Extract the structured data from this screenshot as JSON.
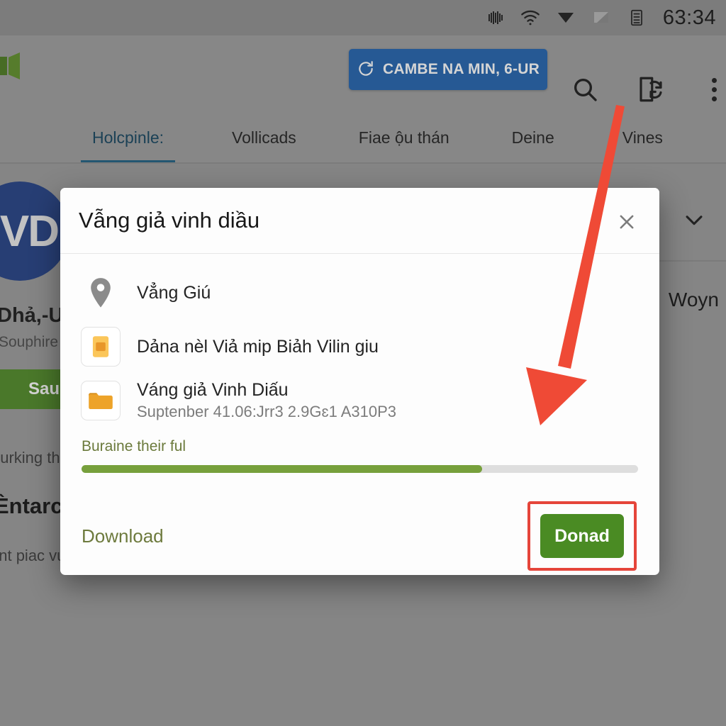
{
  "status_bar": {
    "clock": "63:34",
    "icons": [
      "vibrate-icon",
      "wifi-icon",
      "signal-icon",
      "signal-secondary-icon",
      "battery-icon"
    ]
  },
  "app_bar": {
    "logo": "app-logo-icon",
    "cta_label": "CAMBE NA MIN, 6-UR",
    "cta_icon": "sync-icon",
    "cta_color": "#2062ad",
    "search_icon": "search-icon",
    "cast_icon": "cast-document-icon",
    "overflow_icon": "more-vertical-icon"
  },
  "tabs": [
    {
      "label": "Holcpinle:",
      "active": true
    },
    {
      "label": "Vollicads",
      "active": false
    },
    {
      "label": "Fiae ộu thán",
      "active": false
    },
    {
      "label": "Deine",
      "active": false
    },
    {
      "label": "Vines",
      "active": false
    }
  ],
  "background_page": {
    "logo_text": "VD",
    "logo_color": "#223f85",
    "title": "Dhả,-USỘ",
    "subtitle": "Souphire |",
    "install_label": "Sau",
    "install_color": "#4f8a26",
    "text_line_1": "durking th",
    "text_line_2": "Èntarch",
    "text_line_3": "ent piac vu",
    "right_text": "Woyn",
    "chevron_icon": "chevron-down-icon"
  },
  "dialog": {
    "title": "Vẫng giả vinh diầu",
    "close_icon": "close-icon",
    "rows": [
      {
        "icon": "location-pin-icon",
        "primary": "Vẳng Giú",
        "secondary": ""
      },
      {
        "icon": "sim-card-icon",
        "primary": "Dảna nèl Viả mip Biảh Vilin giu",
        "secondary": ""
      },
      {
        "icon": "folder-icon",
        "primary": "Váng giả Vinh Diấu",
        "secondary": "Suptenber 41.06:Jrr3 2.9Gɛ1 A310P3"
      }
    ],
    "progress": {
      "label": "Buraine their ful",
      "percent": 72,
      "fill_color": "#77a03c",
      "track_color": "#dedede"
    },
    "footer": {
      "secondary_label": "Download",
      "primary_label": "Donad",
      "primary_color": "#4a8b23",
      "highlight_color": "#e5453a"
    }
  },
  "annotation": {
    "arrow_color": "#ef4a36",
    "arrow_from": "880,152",
    "arrow_to": "765,595"
  }
}
